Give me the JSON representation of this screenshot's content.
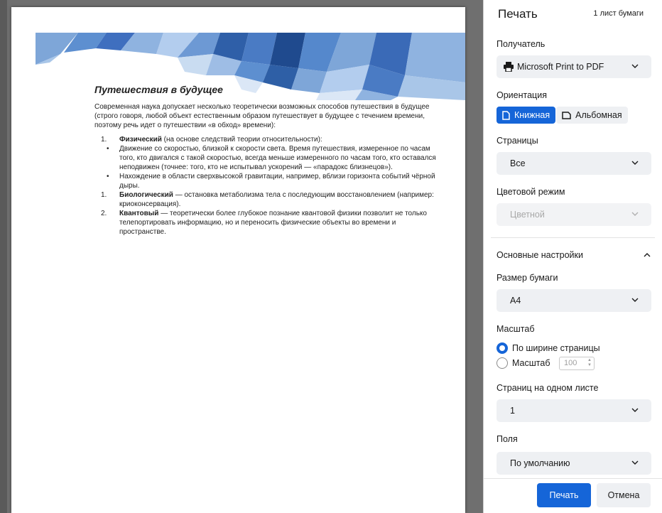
{
  "dialog": {
    "title": "Печать",
    "sheets": "1 лист бумаги"
  },
  "destination": {
    "label": "Получатель",
    "value": "Microsoft Print to PDF",
    "icon": "printer-icon"
  },
  "orientation": {
    "label": "Ориентация",
    "portrait": "Книжная",
    "landscape": "Альбомная",
    "selected": "portrait"
  },
  "pages": {
    "label": "Страницы",
    "value": "Все"
  },
  "color": {
    "label": "Цветовой режим",
    "value": "Цветной"
  },
  "advanced": {
    "label": "Основные настройки",
    "paper": {
      "label": "Размер бумаги",
      "value": "A4"
    },
    "scale": {
      "label": "Масштаб",
      "fit": "По ширине страницы",
      "custom": "Масштаб",
      "custom_value": "100"
    },
    "per_sheet": {
      "label": "Страниц на одном листе",
      "value": "1"
    },
    "margins": {
      "label": "Поля",
      "value": "По умолчанию"
    }
  },
  "buttons": {
    "print": "Печать",
    "cancel": "Отмена"
  },
  "colors": {
    "accent": "#1565d8",
    "banner_dark": "#2e5fa6",
    "banner_light": "#c9dcf1"
  },
  "document": {
    "title": "Путешествия в будущее",
    "intro": "Современная наука допускает несколько теоретически возможных способов путешествия в будущее (строго говоря, любой объект естественным образом путешествует в будущее с течением времени, поэтому речь идет о путешествии «в обход» времени):",
    "items": [
      {
        "num": "1.",
        "bold": "Физический",
        "text": " (на основе следствий теории относительности):"
      },
      {
        "bullet": "Движение со скоростью, близкой к скорости света. Время путешествия, измеренное по часам того, кто двигался с такой скоростью, всегда меньше измеренного по часам того, кто оставался неподвижен (точнее: того, кто не испытывал ускорений — «парадокс близнецов»)."
      },
      {
        "bullet": "Нахождение в области сверхвысокой гравитации, например, вблизи горизонта событий чёрной дыры."
      },
      {
        "num": "1.",
        "bold": "Биологический",
        "text": " — остановка метаболизма тела с последующим восстановлением (например: криоконсервация)."
      },
      {
        "num": "2.",
        "bold": "Квантовый",
        "text": " — теоретически более глубокое познание квантовой физики позволит не только телепортировать информацию, но и переносить физические объекты во времени и пространстве."
      }
    ]
  }
}
